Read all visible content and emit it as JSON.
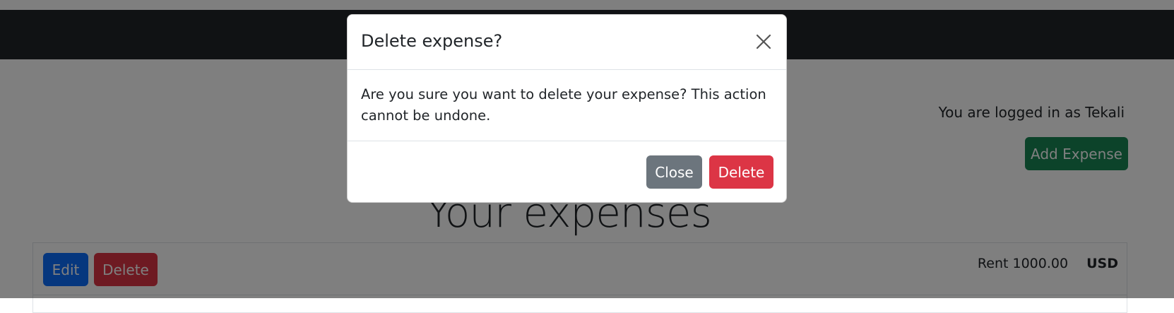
{
  "page": {
    "login_text": "You are logged in as Tekali",
    "add_expense_label": "Add Expense",
    "title": "Your expenses"
  },
  "expenses": [
    {
      "edit_label": "Edit",
      "delete_label": "Delete",
      "name": "Rent",
      "amount": "1000.00",
      "currency": "USD"
    }
  ],
  "modal": {
    "title": "Delete expense?",
    "message": "Are you sure you want to delete your expense? This action cannot be undone.",
    "close_label": "Close",
    "delete_label": "Delete",
    "close_icon": "close-icon"
  },
  "colors": {
    "navbar": "#212529",
    "success": "#198754",
    "primary": "#0d6efd",
    "danger": "#dc3545",
    "secondary": "#6c757d"
  }
}
